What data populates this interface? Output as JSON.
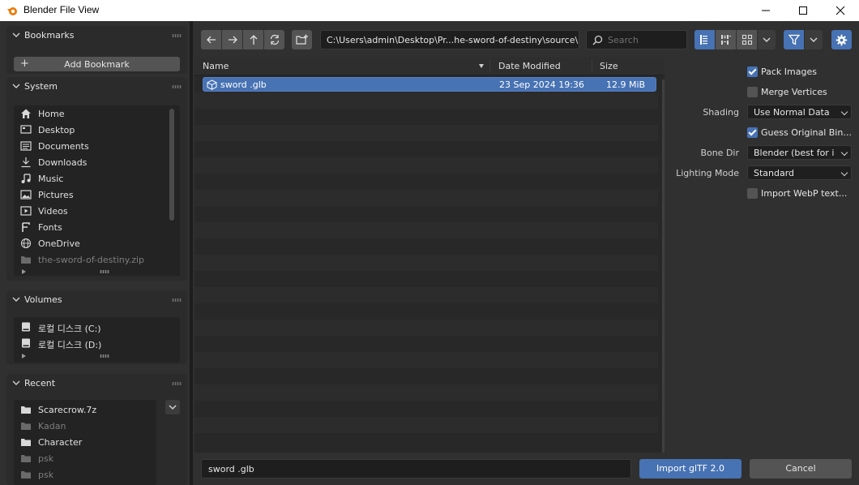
{
  "window": {
    "title": "Blender File View"
  },
  "bookmarks": {
    "title": "Bookmarks",
    "add_label": "Add Bookmark"
  },
  "system": {
    "title": "System",
    "items": [
      {
        "label": "Home",
        "icon": "home-icon"
      },
      {
        "label": "Desktop",
        "icon": "desktop-icon"
      },
      {
        "label": "Documents",
        "icon": "documents-icon"
      },
      {
        "label": "Downloads",
        "icon": "downloads-icon"
      },
      {
        "label": "Music",
        "icon": "music-icon"
      },
      {
        "label": "Pictures",
        "icon": "pictures-icon"
      },
      {
        "label": "Videos",
        "icon": "videos-icon"
      },
      {
        "label": "Fonts",
        "icon": "fonts-icon"
      },
      {
        "label": "OneDrive",
        "icon": "globe-icon"
      },
      {
        "label": "the-sword-of-destiny.zip",
        "icon": "folder-icon"
      }
    ]
  },
  "volumes": {
    "title": "Volumes",
    "items": [
      {
        "label": "로컬 디스크 (C:)"
      },
      {
        "label": "로컬 디스크 (D:)"
      }
    ]
  },
  "recent": {
    "title": "Recent",
    "items": [
      {
        "label": "Scarecrow.7z"
      },
      {
        "label": "Kadan"
      },
      {
        "label": "Character"
      },
      {
        "label": "psk"
      },
      {
        "label": "psk"
      }
    ]
  },
  "toolbar": {
    "path": "C:\\Users\\admin\\Desktop\\Pr...he-sword-of-destiny\\source\\",
    "search_placeholder": "Search"
  },
  "file_list": {
    "columns": {
      "name": "Name",
      "date": "Date Modified",
      "size": "Size"
    },
    "files": [
      {
        "name": "sword .glb",
        "date": "23 Sep 2024 19:36",
        "size": "12.9 MiB"
      }
    ]
  },
  "options": {
    "pack_images": "Pack Images",
    "merge_vertices": "Merge Vertices",
    "shading_label": "Shading",
    "shading_value": "Use Normal Data",
    "guess_bind": "Guess Original Bin...",
    "bone_dir_label": "Bone Dir",
    "bone_dir_value": "Blender (best for i...",
    "lighting_label": "Lighting Mode",
    "lighting_value": "Standard",
    "import_webp": "Import WebP text..."
  },
  "bottom": {
    "filename": "sword .glb",
    "import_label": "Import glTF 2.0",
    "cancel_label": "Cancel"
  },
  "colors": {
    "accent": "#4772b3",
    "panel": "#2b2b2b",
    "background": "#303030"
  }
}
